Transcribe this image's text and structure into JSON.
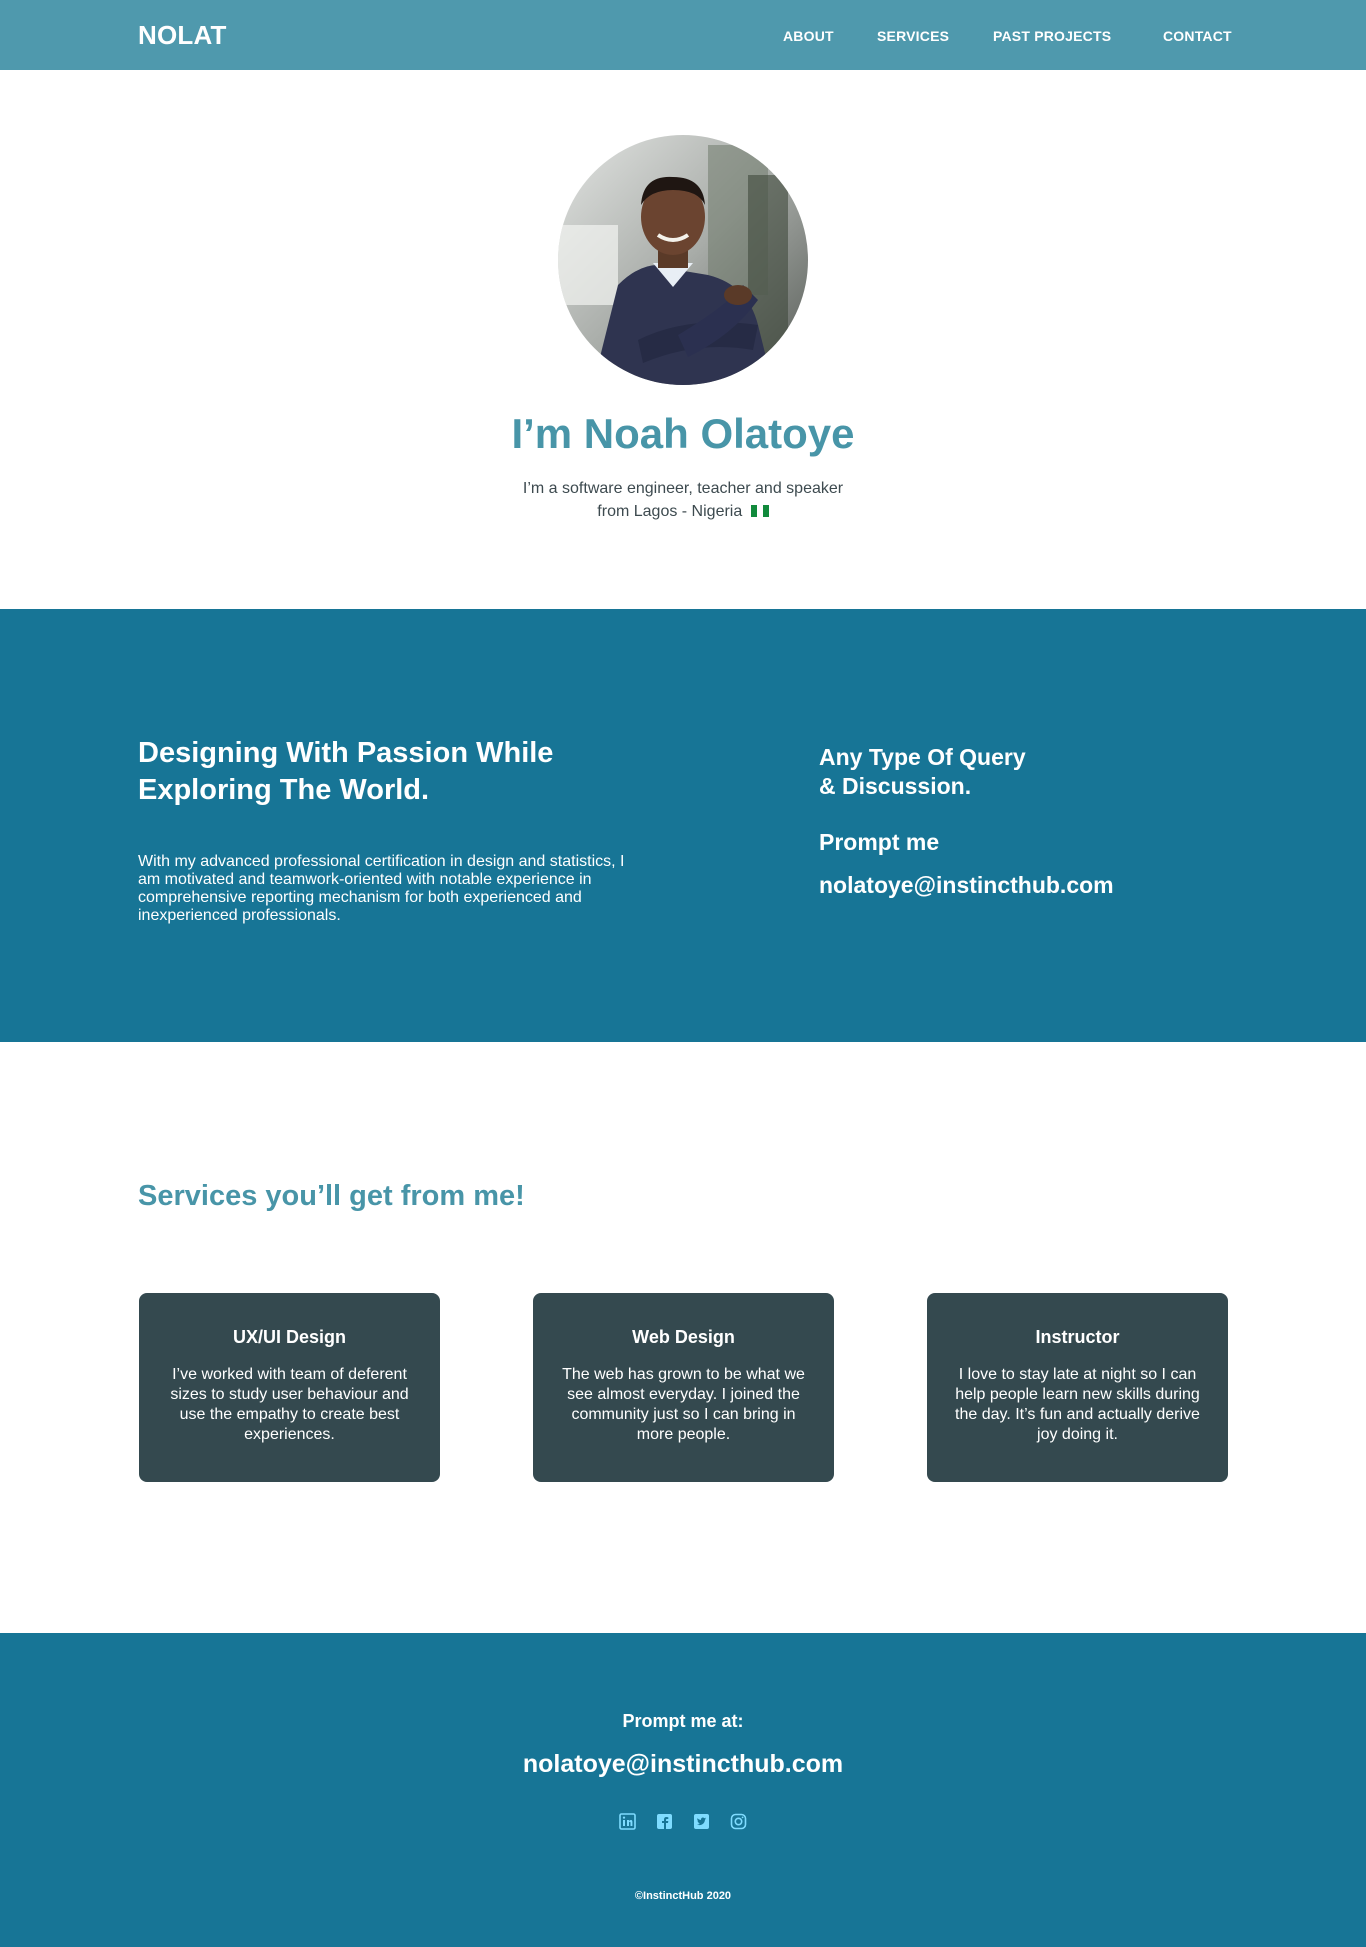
{
  "nav": {
    "logo": "NOLAT",
    "links": [
      "ABOUT",
      "SERVICES",
      "PAST PROJECTS",
      "CONTACT"
    ]
  },
  "hero": {
    "title": "I’m Noah Olatoye",
    "subtitle_line1": "I’m a software engineer, teacher and speaker",
    "subtitle_line2": "from Lagos - Nigeria"
  },
  "about": {
    "heading_line1": "Designing With Passion While",
    "heading_line2": "Exploring The World.",
    "text": "With my advanced professional certification in design and statistics, I am motivated and teamwork-oriented with notable experience in comprehensive reporting mechanism for both experienced and inexperienced professionals.",
    "query_line1": "Any Type Of Query",
    "query_line2": "& Discussion.",
    "prompt_label": "Prompt me",
    "email": "nolatoye@instincthub.com"
  },
  "services": {
    "title": "Services you’ll get from me!",
    "cards": [
      {
        "title": "UX/UI Design",
        "text": "I’ve worked with team of deferent sizes to study user behaviour and use the empathy to create best experiences."
      },
      {
        "title": "Web Design",
        "text": "The web has grown to be what we see almost everyday. I joined the community just so I can bring in more people."
      },
      {
        "title": "Instructor",
        "text": "I love to stay late at night so I can help people learn new skills during the day. It’s fun and actually derive joy doing it."
      }
    ]
  },
  "footer": {
    "label": "Prompt me at:",
    "email": "nolatoye@instincthub.com",
    "socials": [
      "linkedin-icon",
      "facebook-icon",
      "twitter-icon",
      "instagram-icon"
    ],
    "copyright": "©InstinctHub 2020"
  },
  "colors": {
    "nav_bg": "#4f99ad",
    "accent_text": "#4895a8",
    "section_bg": "#177596",
    "card_bg": "#34494f",
    "social_icon": "#7fdcff"
  }
}
